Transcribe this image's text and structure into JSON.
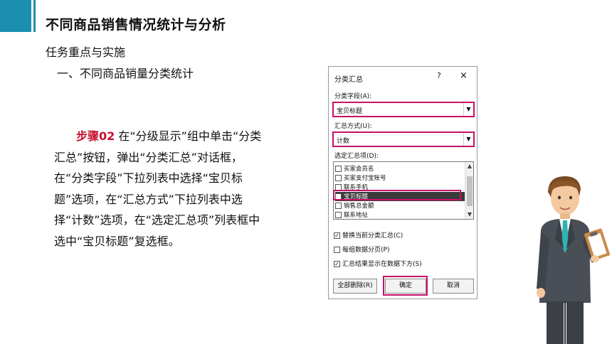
{
  "slide": {
    "title": "不同商品销售情况统计与分析",
    "subtitle": "任务重点与实施",
    "section": "一、不同商品销量分类统计",
    "step_label": "步骤02",
    "step_text": " 在“分级显示”组中单击“分类汇总”按钮，弹出“分类汇总”对话框，在“分类字段”下拉列表中选择“宝贝标题”选项，在“汇总方式”下拉列表中选择“计数”选项，在“选定汇总项”列表框中选中“宝贝标题”复选框。"
  },
  "dialog": {
    "title": "分类汇总",
    "help": "?",
    "close": "×",
    "field_label": "分类字段(A):",
    "field_value": "宝贝标题",
    "method_label": "汇总方式(U):",
    "method_value": "计数",
    "items_label": "选定汇总项(D):",
    "items": [
      {
        "label": "买家会员名",
        "checked": false
      },
      {
        "label": "买家支付宝账号",
        "checked": false
      },
      {
        "label": "联系手机",
        "checked": false
      },
      {
        "label": "宝贝标题",
        "checked": true
      },
      {
        "label": "销售总金额",
        "checked": false
      },
      {
        "label": "联系地址",
        "checked": false
      }
    ],
    "options": [
      {
        "label": "替换当前分类汇总(C)",
        "checked": true
      },
      {
        "label": "每组数据分页(P)",
        "checked": false
      },
      {
        "label": "汇总结果显示在数据下方(S)",
        "checked": true
      }
    ],
    "buttons": {
      "remove_all": "全部删除(R)",
      "ok": "确定",
      "cancel": "取消"
    },
    "highlight_color": "#c8106a"
  },
  "colors": {
    "accent": "#1c8fb0",
    "step_label": "#c8102e"
  }
}
